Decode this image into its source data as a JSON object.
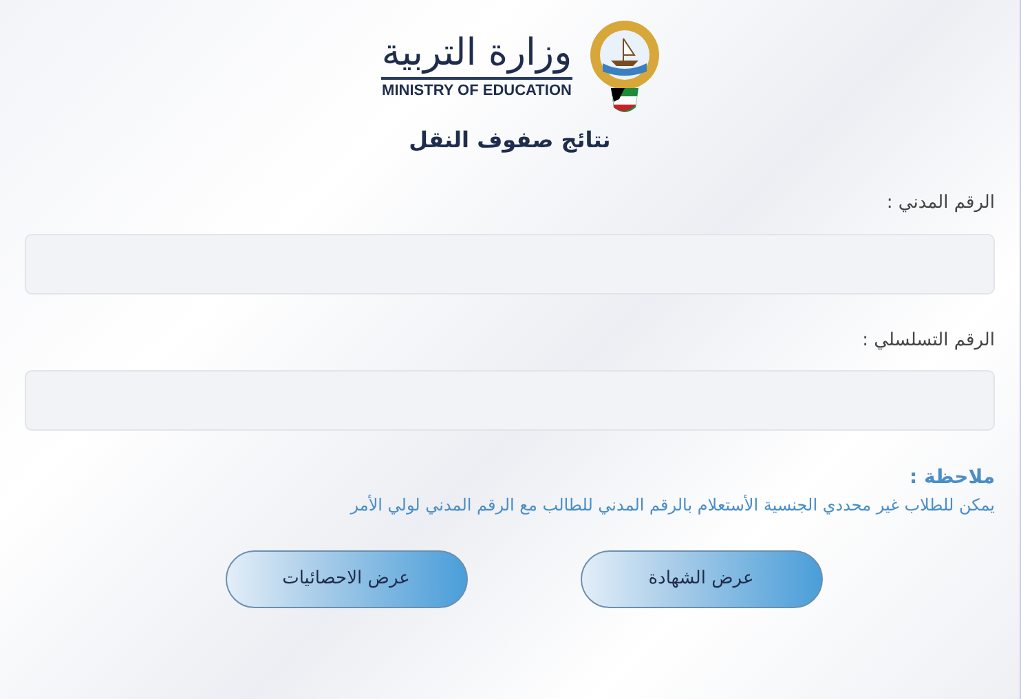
{
  "header": {
    "ministry_name_arabic": "وزارة التربية",
    "ministry_name_english": "MINISTRY OF EDUCATION",
    "page_title": "نتائج صفوف النقل"
  },
  "fields": [
    {
      "label": "الرقم المدني :"
    },
    {
      "label": "الرقم التسلسلي :"
    }
  ],
  "note": {
    "title": "ملاحظة :",
    "text": "يمكن للطلاب غير محددي الجنسية الأستعلام بالرقم المدني للطالب مع الرقم المدني لولي الأمر"
  },
  "buttons": [
    "عرض الشهادة",
    "عرض الاحصائيات"
  ]
}
